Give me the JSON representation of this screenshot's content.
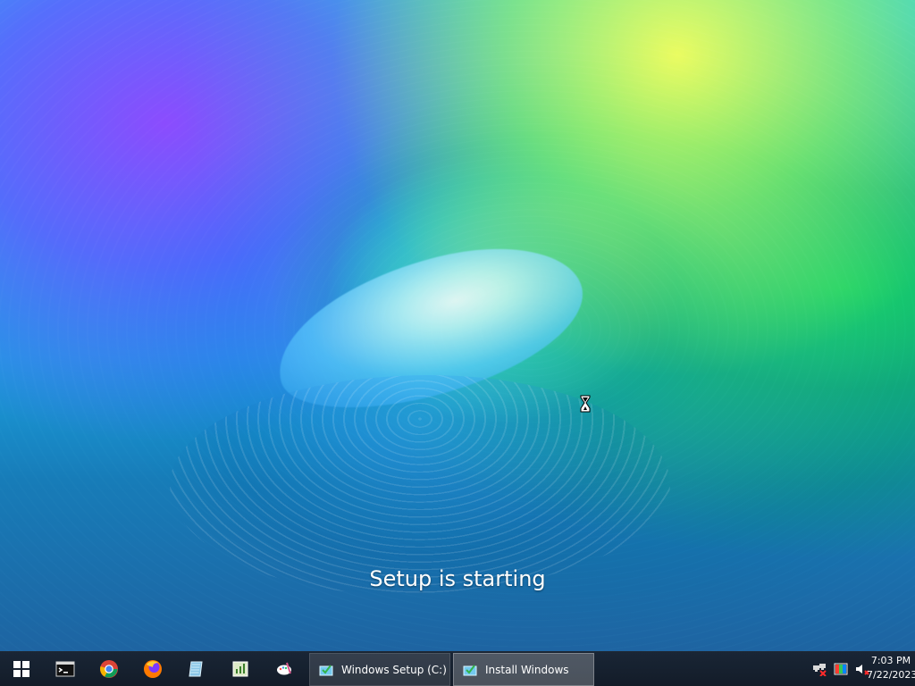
{
  "desktop": {
    "status_text": "Setup is starting"
  },
  "taskbar": {
    "start_icon": "windows-logo-icon",
    "pinned_apps": [
      {
        "icon": "command-prompt-icon"
      },
      {
        "icon": "chrome-icon"
      },
      {
        "icon": "firefox-icon"
      },
      {
        "icon": "document-pad-icon"
      },
      {
        "icon": "chart-editor-icon"
      },
      {
        "icon": "paint-tools-icon"
      }
    ],
    "tasks": [
      {
        "label": "Windows Setup (C:)",
        "icon": "setup-icon",
        "active": false
      },
      {
        "label": "Install Windows",
        "icon": "setup-icon",
        "active": true
      }
    ],
    "tray": {
      "network_icon": "network-disconnected-icon",
      "display_icon": "color-display-icon",
      "volume_icon": "volume-muted-icon",
      "time": "7:03 PM",
      "date": "7/22/2023"
    }
  },
  "colors": {
    "taskbar": "#1b2230",
    "text": "#ffffff",
    "accent": "#3a8fd8"
  }
}
